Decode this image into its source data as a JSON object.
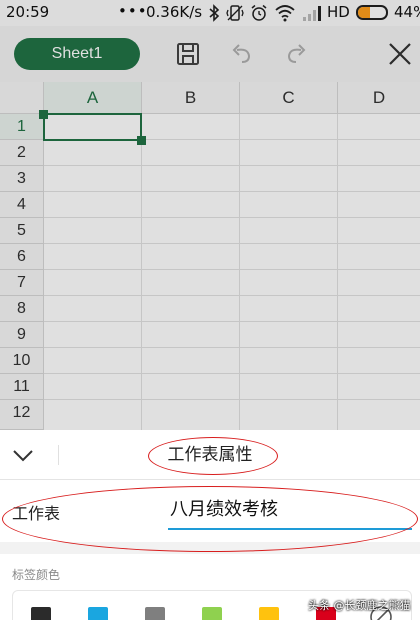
{
  "status_bar": {
    "time": "20:59",
    "dots": "•••",
    "speed": "0.36K/s",
    "network": "HD",
    "battery_pct": "44%",
    "battery_level": 0.44
  },
  "toolbar": {
    "sheet_tab": "Sheet1"
  },
  "grid": {
    "columns": [
      "A",
      "B",
      "C",
      "D"
    ],
    "rows": [
      "1",
      "2",
      "3",
      "4",
      "5",
      "6",
      "7",
      "8",
      "9",
      "10",
      "11",
      "12"
    ],
    "active_column": "A",
    "active_row": "1"
  },
  "panel": {
    "title": "工作表属性",
    "sheet_label": "工作表",
    "sheet_name": "八月绩效考核",
    "tag_color_label": "标签颜色",
    "tag_colors": [
      "#2b2b2b",
      "#1aa6e0",
      "#7f7f7f",
      "#8fd14f",
      "#ffc20e",
      "#d9001b"
    ]
  },
  "colors": {
    "accent": "#217346",
    "input_underline": "#1e9bd7",
    "annotation": "#d81e1e"
  },
  "watermark": "头条 @长颈鹿之熊猫"
}
